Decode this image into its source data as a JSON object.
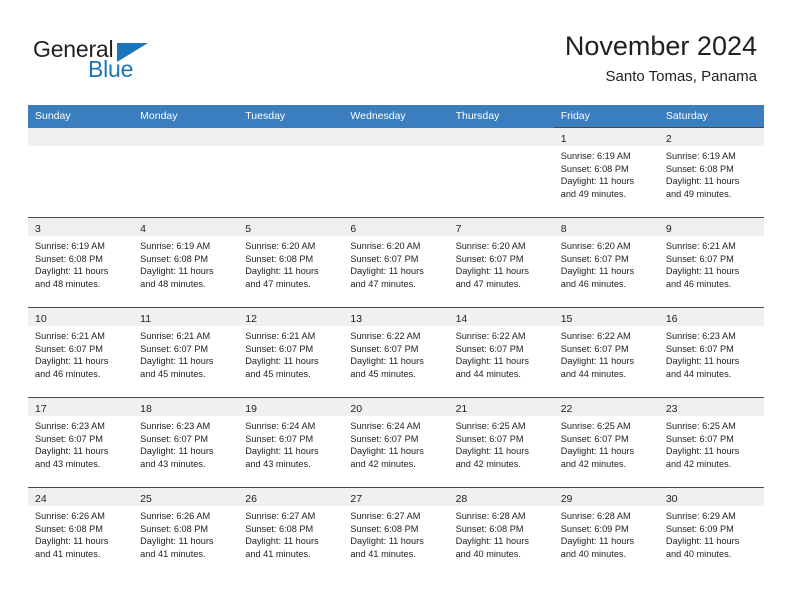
{
  "logo": {
    "word_one": "General",
    "word_two": "Blue",
    "triangle_icon": "triangle-icon",
    "brand_color": "#1b75bb"
  },
  "header": {
    "title": "November 2024",
    "subtitle": "Santo Tomas, Panama"
  },
  "calendar": {
    "header_bg": "#3a7ebf",
    "daynum_band_bg": "#f0f0f0",
    "weekday_headers": [
      "Sunday",
      "Monday",
      "Tuesday",
      "Wednesday",
      "Thursday",
      "Friday",
      "Saturday"
    ],
    "weeks": [
      [
        {
          "day": "",
          "lines": []
        },
        {
          "day": "",
          "lines": []
        },
        {
          "day": "",
          "lines": []
        },
        {
          "day": "",
          "lines": []
        },
        {
          "day": "",
          "lines": []
        },
        {
          "day": "1",
          "lines": [
            "Sunrise: 6:19 AM",
            "Sunset: 6:08 PM",
            "Daylight: 11 hours",
            "and 49 minutes."
          ]
        },
        {
          "day": "2",
          "lines": [
            "Sunrise: 6:19 AM",
            "Sunset: 6:08 PM",
            "Daylight: 11 hours",
            "and 49 minutes."
          ]
        }
      ],
      [
        {
          "day": "3",
          "lines": [
            "Sunrise: 6:19 AM",
            "Sunset: 6:08 PM",
            "Daylight: 11 hours",
            "and 48 minutes."
          ]
        },
        {
          "day": "4",
          "lines": [
            "Sunrise: 6:19 AM",
            "Sunset: 6:08 PM",
            "Daylight: 11 hours",
            "and 48 minutes."
          ]
        },
        {
          "day": "5",
          "lines": [
            "Sunrise: 6:20 AM",
            "Sunset: 6:08 PM",
            "Daylight: 11 hours",
            "and 47 minutes."
          ]
        },
        {
          "day": "6",
          "lines": [
            "Sunrise: 6:20 AM",
            "Sunset: 6:07 PM",
            "Daylight: 11 hours",
            "and 47 minutes."
          ]
        },
        {
          "day": "7",
          "lines": [
            "Sunrise: 6:20 AM",
            "Sunset: 6:07 PM",
            "Daylight: 11 hours",
            "and 47 minutes."
          ]
        },
        {
          "day": "8",
          "lines": [
            "Sunrise: 6:20 AM",
            "Sunset: 6:07 PM",
            "Daylight: 11 hours",
            "and 46 minutes."
          ]
        },
        {
          "day": "9",
          "lines": [
            "Sunrise: 6:21 AM",
            "Sunset: 6:07 PM",
            "Daylight: 11 hours",
            "and 46 minutes."
          ]
        }
      ],
      [
        {
          "day": "10",
          "lines": [
            "Sunrise: 6:21 AM",
            "Sunset: 6:07 PM",
            "Daylight: 11 hours",
            "and 46 minutes."
          ]
        },
        {
          "day": "11",
          "lines": [
            "Sunrise: 6:21 AM",
            "Sunset: 6:07 PM",
            "Daylight: 11 hours",
            "and 45 minutes."
          ]
        },
        {
          "day": "12",
          "lines": [
            "Sunrise: 6:21 AM",
            "Sunset: 6:07 PM",
            "Daylight: 11 hours",
            "and 45 minutes."
          ]
        },
        {
          "day": "13",
          "lines": [
            "Sunrise: 6:22 AM",
            "Sunset: 6:07 PM",
            "Daylight: 11 hours",
            "and 45 minutes."
          ]
        },
        {
          "day": "14",
          "lines": [
            "Sunrise: 6:22 AM",
            "Sunset: 6:07 PM",
            "Daylight: 11 hours",
            "and 44 minutes."
          ]
        },
        {
          "day": "15",
          "lines": [
            "Sunrise: 6:22 AM",
            "Sunset: 6:07 PM",
            "Daylight: 11 hours",
            "and 44 minutes."
          ]
        },
        {
          "day": "16",
          "lines": [
            "Sunrise: 6:23 AM",
            "Sunset: 6:07 PM",
            "Daylight: 11 hours",
            "and 44 minutes."
          ]
        }
      ],
      [
        {
          "day": "17",
          "lines": [
            "Sunrise: 6:23 AM",
            "Sunset: 6:07 PM",
            "Daylight: 11 hours",
            "and 43 minutes."
          ]
        },
        {
          "day": "18",
          "lines": [
            "Sunrise: 6:23 AM",
            "Sunset: 6:07 PM",
            "Daylight: 11 hours",
            "and 43 minutes."
          ]
        },
        {
          "day": "19",
          "lines": [
            "Sunrise: 6:24 AM",
            "Sunset: 6:07 PM",
            "Daylight: 11 hours",
            "and 43 minutes."
          ]
        },
        {
          "day": "20",
          "lines": [
            "Sunrise: 6:24 AM",
            "Sunset: 6:07 PM",
            "Daylight: 11 hours",
            "and 42 minutes."
          ]
        },
        {
          "day": "21",
          "lines": [
            "Sunrise: 6:25 AM",
            "Sunset: 6:07 PM",
            "Daylight: 11 hours",
            "and 42 minutes."
          ]
        },
        {
          "day": "22",
          "lines": [
            "Sunrise: 6:25 AM",
            "Sunset: 6:07 PM",
            "Daylight: 11 hours",
            "and 42 minutes."
          ]
        },
        {
          "day": "23",
          "lines": [
            "Sunrise: 6:25 AM",
            "Sunset: 6:07 PM",
            "Daylight: 11 hours",
            "and 42 minutes."
          ]
        }
      ],
      [
        {
          "day": "24",
          "lines": [
            "Sunrise: 6:26 AM",
            "Sunset: 6:08 PM",
            "Daylight: 11 hours",
            "and 41 minutes."
          ]
        },
        {
          "day": "25",
          "lines": [
            "Sunrise: 6:26 AM",
            "Sunset: 6:08 PM",
            "Daylight: 11 hours",
            "and 41 minutes."
          ]
        },
        {
          "day": "26",
          "lines": [
            "Sunrise: 6:27 AM",
            "Sunset: 6:08 PM",
            "Daylight: 11 hours",
            "and 41 minutes."
          ]
        },
        {
          "day": "27",
          "lines": [
            "Sunrise: 6:27 AM",
            "Sunset: 6:08 PM",
            "Daylight: 11 hours",
            "and 41 minutes."
          ]
        },
        {
          "day": "28",
          "lines": [
            "Sunrise: 6:28 AM",
            "Sunset: 6:08 PM",
            "Daylight: 11 hours",
            "and 40 minutes."
          ]
        },
        {
          "day": "29",
          "lines": [
            "Sunrise: 6:28 AM",
            "Sunset: 6:09 PM",
            "Daylight: 11 hours",
            "and 40 minutes."
          ]
        },
        {
          "day": "30",
          "lines": [
            "Sunrise: 6:29 AM",
            "Sunset: 6:09 PM",
            "Daylight: 11 hours",
            "and 40 minutes."
          ]
        }
      ]
    ]
  }
}
